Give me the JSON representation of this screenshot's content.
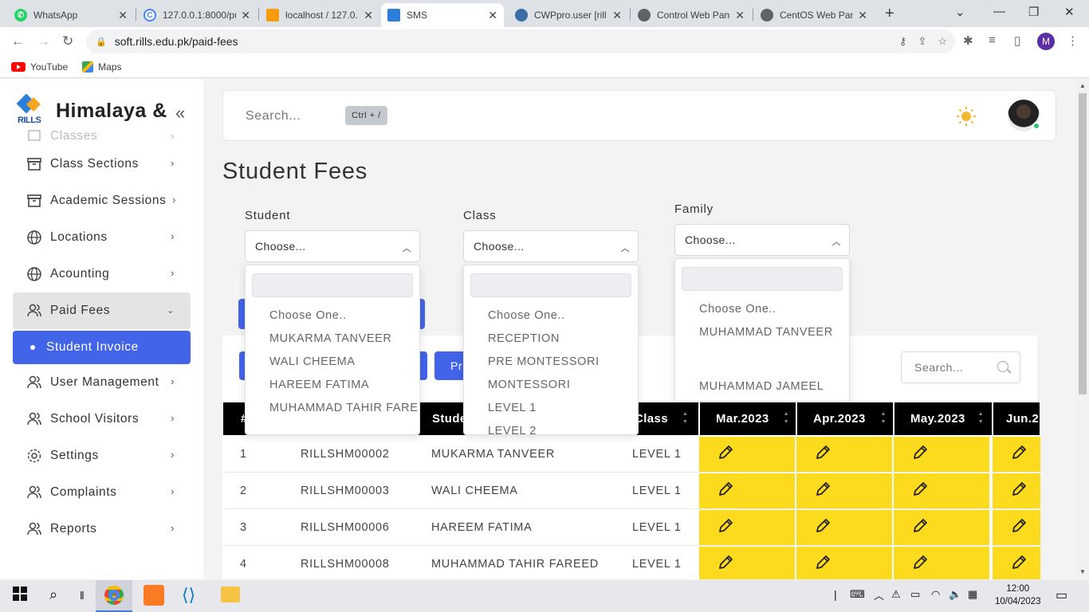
{
  "browser": {
    "tabs": [
      {
        "label": "WhatsApp"
      },
      {
        "label": "127.0.0.1:8000/pu"
      },
      {
        "label": "localhost / 127.0."
      },
      {
        "label": "SMS"
      },
      {
        "label": "CWPpro.user [rill"
      },
      {
        "label": "Control Web Pan"
      },
      {
        "label": "CentOS Web Pan"
      }
    ],
    "url": "soft.rills.edu.pk/paid-fees",
    "bookmarks": [
      "YouTube",
      "Maps"
    ],
    "profile_initial": "M"
  },
  "sidebar": {
    "brand_title": "Himalaya &",
    "logo_text": "RILLS",
    "items": [
      {
        "label": "Classes"
      },
      {
        "label": "Class Sections"
      },
      {
        "label": "Academic Sessions"
      },
      {
        "label": "Locations"
      },
      {
        "label": "Acounting"
      },
      {
        "label": "Paid Fees"
      },
      {
        "label": "Student Invoice"
      },
      {
        "label": "User Management"
      },
      {
        "label": "School Visitors"
      },
      {
        "label": "Settings"
      },
      {
        "label": "Complaints"
      },
      {
        "label": "Reports"
      }
    ]
  },
  "header": {
    "search_placeholder": "Search...",
    "shortcut": "Ctrl + /"
  },
  "page": {
    "title": "Student Fees",
    "filters": {
      "student": {
        "label": "Student",
        "value": "Choose...",
        "options": [
          "Choose One..",
          "MUKARMA TANVEER",
          "WALI CHEEMA",
          "HAREEM FATIMA",
          "MUHAMMAD TAHIR FARE"
        ]
      },
      "class": {
        "label": "Class",
        "value": "Choose...",
        "options": [
          "Choose One..",
          "RECEPTION",
          "PRE MONTESSORI",
          "MONTESSORI",
          "LEVEL 1",
          "LEVEL 2"
        ]
      },
      "family": {
        "label": "Family",
        "value": "Choose...",
        "options": [
          "Choose One..",
          "MUHAMMAD TANVEER",
          "",
          "MUHAMMAD JAMEEL"
        ]
      }
    },
    "partial_button": "Pr",
    "table_search_placeholder": "Search...",
    "table": {
      "headers": [
        "#",
        "Stude",
        "Class",
        "Mar.2023",
        "Apr.2023",
        "May.2023",
        "Jun.2"
      ],
      "rows": [
        {
          "num": "1",
          "id": "RILLSHM00002",
          "name": "MUKARMA TANVEER",
          "class": "LEVEL 1"
        },
        {
          "num": "2",
          "id": "RILLSHM00003",
          "name": "WALI CHEEMA",
          "class": "LEVEL 1"
        },
        {
          "num": "3",
          "id": "RILLSHM00006",
          "name": "HAREEM FATIMA",
          "class": "LEVEL 1"
        },
        {
          "num": "4",
          "id": "RILLSHM00008",
          "name": "MUHAMMAD TAHIR FAREED",
          "class": "LEVEL 1"
        }
      ]
    }
  },
  "taskbar": {
    "time": "12:00",
    "date": "10/04/2023"
  },
  "colors": {
    "accent": "#4264e9",
    "fee_cell": "#fcdb1e",
    "table_header": "#000000"
  },
  "icons": [
    "pencil-icon",
    "sun-icon",
    "search-icon",
    "chevron-right-icon",
    "chevron-down-icon",
    "double-chevron-left-icon"
  ]
}
